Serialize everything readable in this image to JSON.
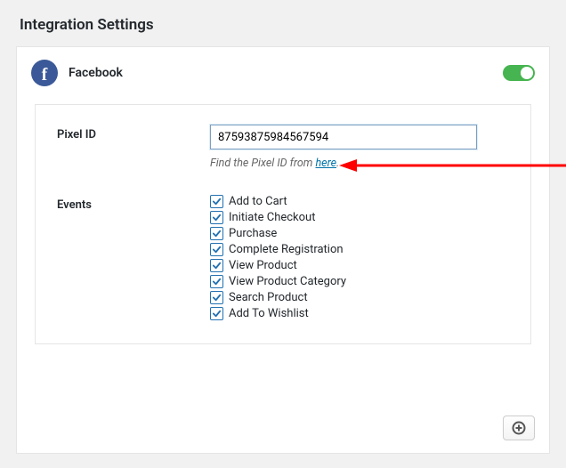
{
  "page": {
    "title": "Integration Settings"
  },
  "integration": {
    "name": "Facebook",
    "icon_letter": "f",
    "enabled": true
  },
  "pixel": {
    "label": "Pixel ID",
    "value": "87593875984567594",
    "hint_prefix": "Find the Pixel ID from ",
    "hint_link_text": "here",
    "hint_suffix": "."
  },
  "events": {
    "label": "Events",
    "items": [
      {
        "label": "Add to Cart",
        "checked": true
      },
      {
        "label": "Initiate Checkout",
        "checked": true
      },
      {
        "label": "Purchase",
        "checked": true
      },
      {
        "label": "Complete Registration",
        "checked": true
      },
      {
        "label": "View Product",
        "checked": true
      },
      {
        "label": "View Product Category",
        "checked": true
      },
      {
        "label": "Search Product",
        "checked": true
      },
      {
        "label": "Add To Wishlist",
        "checked": true
      }
    ]
  },
  "colors": {
    "accent": "#2271b1",
    "toggle_on": "#46b450",
    "facebook": "#3b5998",
    "arrow": "#ff0000"
  }
}
